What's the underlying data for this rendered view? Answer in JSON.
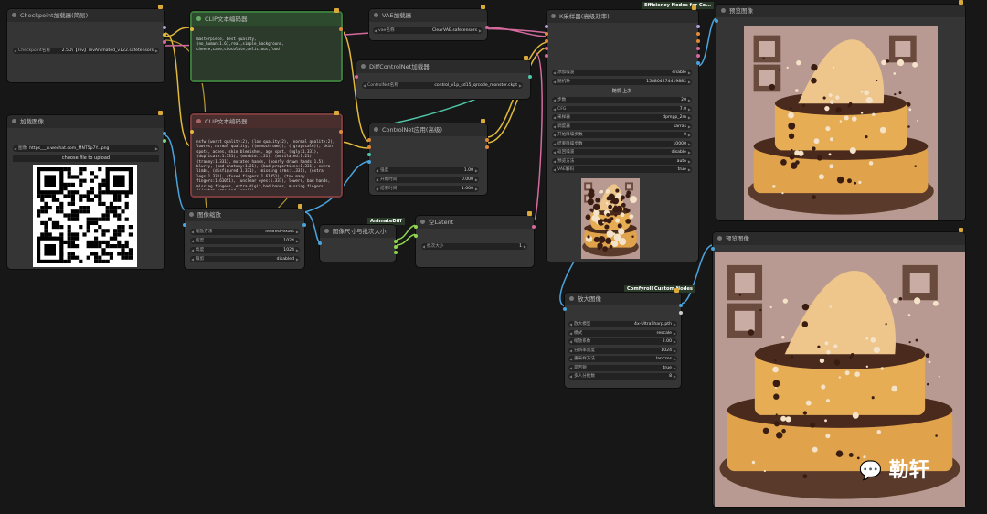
{
  "tags": {
    "efficiency": "Efficiency Nodes for Co...",
    "animatediff": "AnimateDiff",
    "comfyroll": "Comfyroll Custom Nodes"
  },
  "nodes": {
    "checkpoint": {
      "title": "Checkpoint加载器(简易)",
      "widget_label": "Checkpoint名称",
      "widget_value": "2.5D\\【rev】revAnimated_v122.safetensors"
    },
    "clip_pos": {
      "title": "CLIP文本编码器",
      "text": "masterpiece, best quality, (no_human:1.6),real,simple_background, cheese,cake,chocolate,delicious,food"
    },
    "clip_neg": {
      "title": "CLIP文本编码器",
      "text": "nsfw,(worst quality:2), (low quality:2), (normal quality:2), lowres, normal quality, ((monochrome)), ((grayscale)), skin spots, acnes, skin blemishes, age spot, (ugly:1.331), (duplicate:1.331), (morbid:1.21), (mutilated:1.21), (tranny:1.331), mutated hands, (poorly drawn hands:1.5), blurry, (bad anatomy:1.21), (bad proportions:1.331), extra limbs, (disfigured:1.331), (missing arms:1.331), (extra legs:1.331), (fused fingers:1.61051), (too many fingers:1.61051), (unclear eyes:1.331), lowers, bad hands, missing fingers, extra digit,bad hands, missing fingers, (((extra arms and legs))),"
    },
    "vae": {
      "title": "VAE加载器",
      "widget_label": "vae名称",
      "widget_value": "ClearVAE.safetensors"
    },
    "diff_cn": {
      "title": "DiffControlNet加载器",
      "widget_label": "ControlNet名称",
      "widget_value": "control_v1p_sd15_qrcode_monster.ckpt"
    },
    "cn_apply": {
      "title": "ControlNet应用(高级)",
      "rows": [
        {
          "label": "强度",
          "value": "1.00"
        },
        {
          "label": "开始时间",
          "value": "0.000"
        },
        {
          "label": "结束时间",
          "value": "1.000"
        }
      ]
    },
    "load_image": {
      "title": "加载图像",
      "widget_label": "图像",
      "widget_value": "https___u.wechat.com_MNT5p7Y...png",
      "upload": "choose file to upload"
    },
    "image_scale": {
      "title": "图像缩放",
      "rows": [
        {
          "label": "缩放方法",
          "value": "nearest-exact"
        },
        {
          "label": "宽度",
          "value": "1024"
        },
        {
          "label": "高度",
          "value": "1024"
        },
        {
          "label": "裁剪",
          "value": "disabled"
        }
      ]
    },
    "img_size": {
      "title": "图像尺寸与批次大小"
    },
    "empty_latent": {
      "title": "空Latent",
      "widget_label": "批次大小",
      "widget_value": "1"
    },
    "ksampler": {
      "title": "K采样器(高级效率)",
      "rows_top": [
        {
          "label": "添加噪波",
          "value": "enable"
        },
        {
          "label": "随机种",
          "value": "158804274419882"
        }
      ],
      "seed_controls": "随机  上次",
      "rows": [
        {
          "label": "步数",
          "value": "20"
        },
        {
          "label": "CFG",
          "value": "7.0"
        },
        {
          "label": "采样器",
          "value": "dpmpp_2m"
        },
        {
          "label": "调度器",
          "value": "karras"
        },
        {
          "label": "开始降噪步数",
          "value": "0"
        },
        {
          "label": "结束降噪步数",
          "value": "10000"
        },
        {
          "label": "返回噪波",
          "value": "disable"
        },
        {
          "label": "预览方法",
          "value": "auto"
        },
        {
          "label": "VAE解码",
          "value": "true"
        }
      ]
    },
    "preview1": {
      "title": "预览图像"
    },
    "preview2": {
      "title": "预览图像"
    },
    "upscale": {
      "title": "放大图像",
      "rows": [
        {
          "label": "放大模型",
          "value": "4x-UltraSharp.pth"
        },
        {
          "label": "模式",
          "value": "rescale"
        },
        {
          "label": "缩放系数",
          "value": "2.00"
        },
        {
          "label": "分辨率宽度",
          "value": "1024"
        },
        {
          "label": "重采样方法",
          "value": "lanczos"
        },
        {
          "label": "是否锐",
          "value": "true"
        },
        {
          "label": "多人分批数",
          "value": "8"
        }
      ]
    }
  },
  "watermark": "勒轩",
  "colors": {
    "wire_yellow": "#e0b93d",
    "wire_pink": "#d46a9e",
    "wire_blue": "#4ba3db",
    "wire_teal": "#4ec7a7",
    "wire_orange": "#e08a3a",
    "wire_green": "#8ed44f"
  }
}
